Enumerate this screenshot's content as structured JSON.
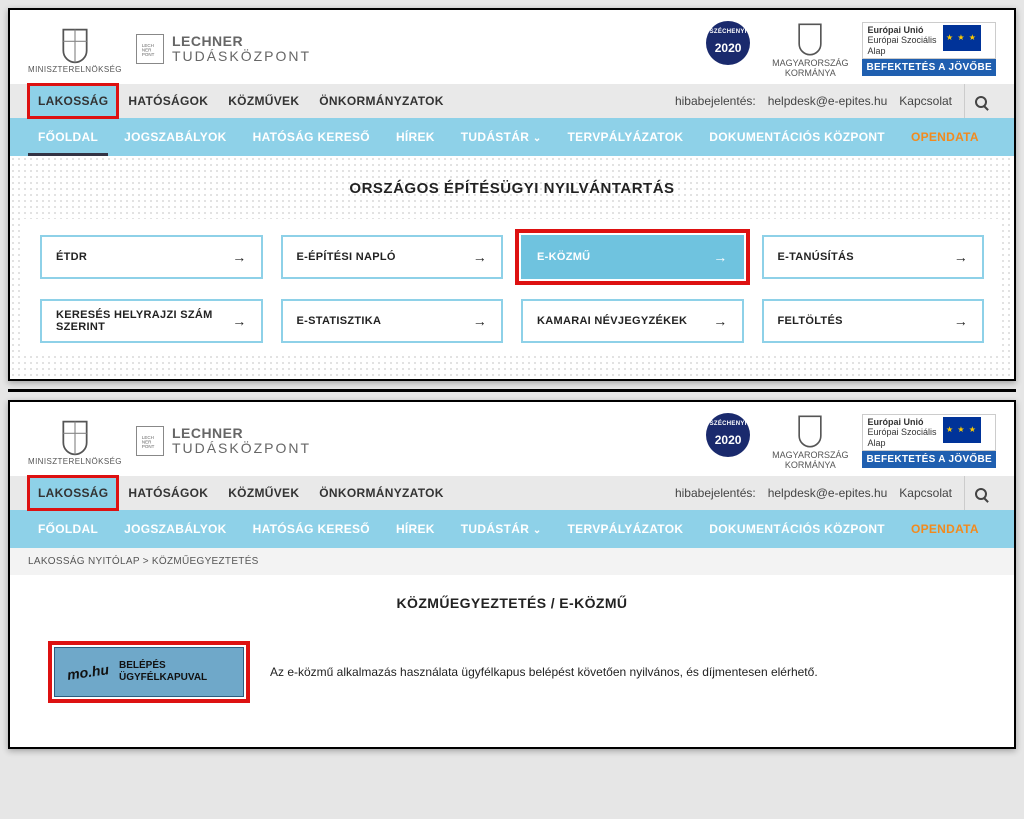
{
  "header": {
    "ministry_label": "MINISZTERELNÖKSÉG",
    "lechner_line1": "LECHNER",
    "lechner_line2": "TUDÁSKÖZPONT",
    "szechenyi_small": "SZÉCHENYI",
    "szechenyi_year": "2020",
    "magyarorszag": "MAGYARORSZÁG",
    "kormanya": "KORMÁNYA",
    "eu_line1": "Európai Unió",
    "eu_line2": "Európai Szociális",
    "eu_line3": "Alap",
    "eu_banner": "BEFEKTETÉS A JÖVŐBE"
  },
  "topnav": {
    "tabs": [
      "LAKOSSÁG",
      "HATÓSÁGOK",
      "KÖZMŰVEK",
      "ÖNKORMÁNYZATOK"
    ],
    "hiba_label": "hibabejelentés:",
    "hiba_email": "helpdesk@e-epites.hu",
    "kapcsolat": "Kapcsolat"
  },
  "subnav": {
    "items": [
      "FŐOLDAL",
      "JOGSZABÁLYOK",
      "HATÓSÁG KERESŐ",
      "HÍREK",
      "TUDÁSTÁR",
      "TERVPÁLYÁZATOK",
      "DOKUMENTÁCIÓS KÖZPONT",
      "OPENDATA"
    ]
  },
  "upper": {
    "page_title": "ORSZÁGOS ÉPÍTÉSÜGYI NYILVÁNTARTÁS",
    "tiles": [
      "ÉTDR",
      "E-ÉPÍTÉSI NAPLÓ",
      "E-KÖZMŰ",
      "E-TANÚSÍTÁS",
      "KERESÉS HELYRAJZI SZÁM SZERINT",
      "E-STATISZTIKA",
      "KAMARAI NÉVJEGYZÉKEK",
      "FELTÖLTÉS"
    ]
  },
  "lower": {
    "breadcrumb": "LAKOSSÁG NYITÓLAP > KÖZMŰEGYEZTETÉS",
    "page_title": "KÖZMŰEGYEZTETÉS / E-KÖZMŰ",
    "login_line1": "BELÉPÉS",
    "login_line2": "ÜGYFÉLKAPUVAL",
    "description": "Az e-közmű alkalmazás használata ügyfélkapus belépést követően nyilvános, és díjmentesen elérhető."
  }
}
